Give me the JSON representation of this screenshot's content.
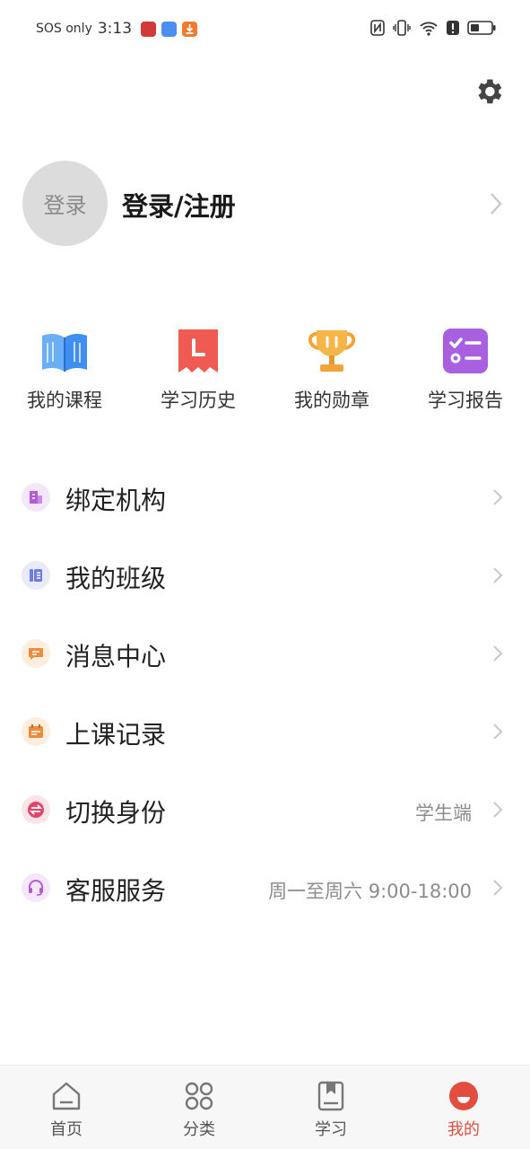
{
  "status_bar": {
    "carrier": "SOS only",
    "time": "3:13",
    "colors": {
      "app1": "#d23a3a",
      "app2": "#4a8ff0",
      "app3": "#f07a2e"
    }
  },
  "profile": {
    "avatar_text": "登录",
    "title": "登录/注册"
  },
  "quick_links": [
    {
      "label": "我的课程",
      "icon": "open-book-icon",
      "color": "#3f8ff0"
    },
    {
      "label": "学习历史",
      "icon": "history-bookmark-icon",
      "color": "#ef5a52"
    },
    {
      "label": "我的勋章",
      "icon": "trophy-icon",
      "color": "#f2a33a"
    },
    {
      "label": "学习报告",
      "icon": "report-list-icon",
      "color": "#a85fe0"
    }
  ],
  "menu": [
    {
      "label": "绑定机构",
      "value": "",
      "icon": "building-icon",
      "color": "#b35bd6",
      "bg": "#f4e6fb"
    },
    {
      "label": "我的班级",
      "value": "",
      "icon": "class-icon",
      "color": "#6f7be6",
      "bg": "#e9ebfb"
    },
    {
      "label": "消息中心",
      "value": "",
      "icon": "message-icon",
      "color": "#ee8a3c",
      "bg": "#fdeedd"
    },
    {
      "label": "上课记录",
      "value": "",
      "icon": "calendar-icon",
      "color": "#ee8a3c",
      "bg": "#fdeedd"
    },
    {
      "label": "切换身份",
      "value": "学生端",
      "icon": "switch-icon",
      "color": "#e2456a",
      "bg": "#fbe3ea"
    },
    {
      "label": "客服服务",
      "value": "周一至周六 9:00-18:00",
      "icon": "headset-icon",
      "color": "#b45ad8",
      "bg": "#f4e6fb"
    }
  ],
  "bottom_nav": [
    {
      "label": "首页",
      "icon": "home-icon",
      "active": false
    },
    {
      "label": "分类",
      "icon": "category-icon",
      "active": false
    },
    {
      "label": "学习",
      "icon": "book-icon",
      "active": false
    },
    {
      "label": "我的",
      "icon": "profile-icon",
      "active": true
    }
  ],
  "accent_color": "#e24d3d"
}
